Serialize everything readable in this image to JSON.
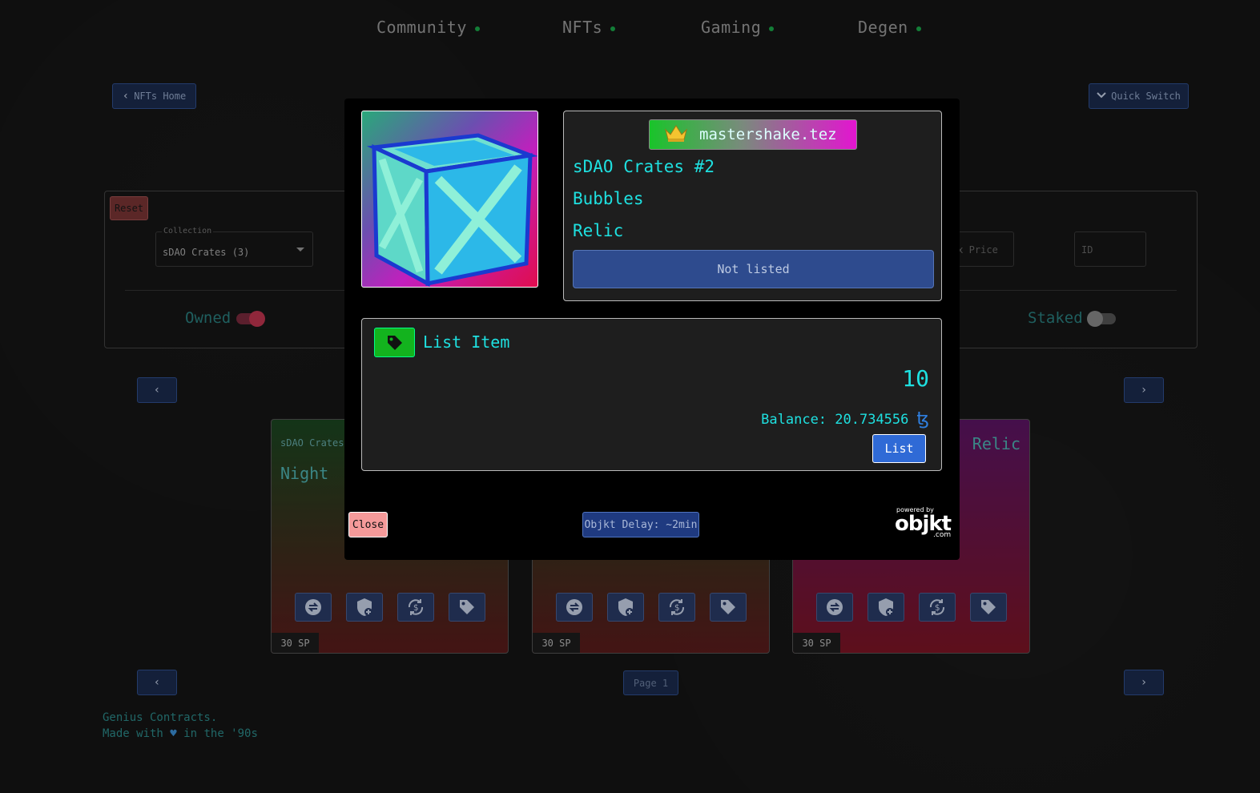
{
  "nav": {
    "items": [
      {
        "label": "Community"
      },
      {
        "label": "NFTs"
      },
      {
        "label": "Gaming"
      },
      {
        "label": "Degen"
      }
    ]
  },
  "toolbar": {
    "nfts_home": "NFTs Home",
    "quick_switch": "Quick Switch"
  },
  "filters": {
    "reset": "Reset",
    "collection_legend": "Collection",
    "collection_value": "sDAO Crates (3)",
    "max_price_placeholder": "ax Price",
    "id_placeholder": "ID",
    "owned_label": "Owned",
    "owned_on": true,
    "staked_label": "Staked",
    "staked_on": false
  },
  "cards": [
    {
      "collection": "sDAO Crates",
      "name": "Night",
      "rarity": "",
      "sp": "30 SP"
    },
    {
      "collection": "",
      "name": "",
      "rarity": "",
      "sp": "30 SP"
    },
    {
      "collection": "",
      "name": "",
      "rarity": "Relic",
      "sp": "30 SP"
    }
  ],
  "pagination": {
    "label": "Page 1"
  },
  "footer": {
    "line1": "Genius Contracts.",
    "line2_pre": "Made with",
    "line2_post": "in the '90s"
  },
  "modal": {
    "owner": "mastershake.tez",
    "title": "sDAO Crates #2",
    "trait": "Bubbles",
    "rarity": "Relic",
    "status": "Not listed",
    "list_title": "List Item",
    "price": "10",
    "balance": "Balance: 20.734556",
    "currency_symbol": "ꜩ",
    "list_button": "List",
    "close_button": "Close",
    "delay": "Objkt Delay: ~2min",
    "powered_by": "powered by",
    "brand": "objkt",
    "brand_suffix": ".com"
  },
  "colors": {
    "accent": "#1ee0e0",
    "nav_dot": "#1aa84a",
    "primary_button": "#2f6ad6",
    "close_button": "#f59a9a"
  }
}
